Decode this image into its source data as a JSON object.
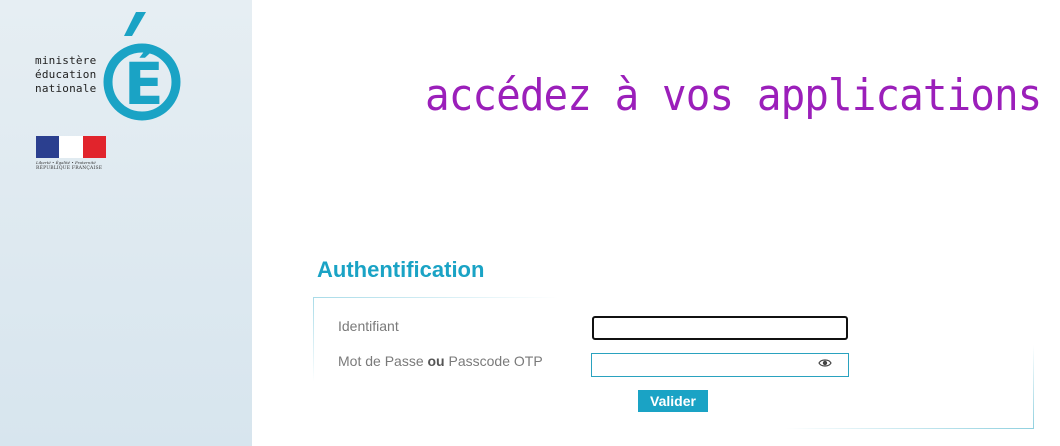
{
  "logo": {
    "line1": "ministère",
    "line2": "éducation",
    "line3": "nationale",
    "letter": "É",
    "motto": "Liberté • Égalité • Fraternité",
    "republic": "RÉPUBLIQUE FRANÇAISE"
  },
  "colors": {
    "accent": "#1aa3c5",
    "headline": "#9b1fba",
    "sidebar": "#dce8ef",
    "flag_blue": "#2b3f8f",
    "flag_red": "#e1242c"
  },
  "headline": "accédez à vos applications",
  "auth": {
    "title": "Authentification",
    "identifiant_label": "Identifiant",
    "identifiant_value": "",
    "password_label_part1": "Mot de Passe ",
    "password_label_bold": "ou",
    "password_label_part2": " Passcode OTP",
    "password_value": "",
    "eye_icon": "eye-icon",
    "submit_label": "Valider"
  }
}
